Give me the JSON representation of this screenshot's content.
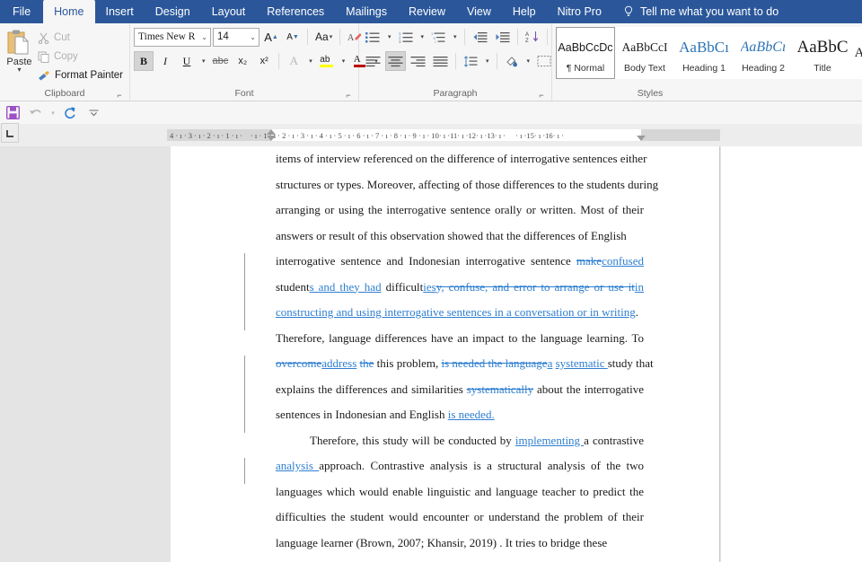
{
  "ribbon": {
    "tabs": [
      {
        "label": "File",
        "kind": "file"
      },
      {
        "label": "Home",
        "kind": "active"
      },
      {
        "label": "Insert",
        "kind": "normal"
      },
      {
        "label": "Design",
        "kind": "normal"
      },
      {
        "label": "Layout",
        "kind": "normal"
      },
      {
        "label": "References",
        "kind": "normal"
      },
      {
        "label": "Mailings",
        "kind": "normal"
      },
      {
        "label": "Review",
        "kind": "normal"
      },
      {
        "label": "View",
        "kind": "normal"
      },
      {
        "label": "Help",
        "kind": "normal"
      },
      {
        "label": "Nitro Pro",
        "kind": "normal"
      }
    ],
    "tellme": "Tell me what you want to do",
    "accent_color": "#2b579a"
  },
  "clipboard": {
    "group_label": "Clipboard",
    "paste_label": "Paste",
    "cut_label": "Cut",
    "copy_label": "Copy",
    "format_painter_label": "Format Painter"
  },
  "font": {
    "group_label": "Font",
    "family": "Times New R",
    "size": "14",
    "bold": "B",
    "italic": "I",
    "underline": "U",
    "strikethrough": "abc",
    "subscript": "x₂",
    "superscript": "x²",
    "change_case": "Aa",
    "grow_font": "A",
    "shrink_font": "A",
    "text_highlight": "ab",
    "font_color": "A"
  },
  "paragraph": {
    "group_label": "Paragraph",
    "pilcrow": "¶",
    "sort": "A\nZ"
  },
  "styles": {
    "group_label": "Styles",
    "items": [
      {
        "preview": "AaBbCcDc",
        "name": "¶ Normal",
        "cls": "sp-normal",
        "selected": true
      },
      {
        "preview": "AaBbCcI",
        "name": "Body Text",
        "cls": "sp-body",
        "selected": false
      },
      {
        "preview": "AaBbCı",
        "name": "Heading 1",
        "cls": "sp-h1",
        "selected": false
      },
      {
        "preview": "AaBbCı",
        "name": "Heading 2",
        "cls": "sp-h2",
        "selected": false
      },
      {
        "preview": "AaBbC",
        "name": "Title",
        "cls": "sp-title",
        "selected": false
      },
      {
        "preview": "A",
        "name": "",
        "cls": "sp-trunc",
        "selected": false
      }
    ]
  },
  "quick_access": {
    "save": "save-icon",
    "undo": "undo-icon",
    "redo": "redo-icon",
    "customize": "customize-icon"
  },
  "ruler": {
    "left_ticks": "4 · ı · 3 · ı · 2 · ı · 1 · ı ·",
    "right_ticks": "· ı · 1 · ı · 2 · ı · 3 · ı · 4 · ı · 5 · ı · 6 · ı · 7 · ı · 8 · ı · 9 · ı · 10· ı ·11· ı ·12· ı ·13· ı ·",
    "tail_ticks": "· ı ·15· ı ·16· ı ·"
  },
  "document": {
    "lines": [
      {
        "changed": false,
        "segments": [
          {
            "t": "items of interview referenced on the difference of interrogative sentences either",
            "s": "n"
          }
        ]
      },
      {
        "changed": false,
        "segments": [
          {
            "t": "structures or types. Moreover, affecting of those differences to the students during",
            "s": "n"
          }
        ]
      },
      {
        "changed": false,
        "segments": [
          {
            "t": "arranging or using the interrogative sentence orally or written. Most of their",
            "s": "n"
          }
        ]
      },
      {
        "changed": false,
        "segments": [
          {
            "t": "answers or result of this observation showed that the differences of English",
            "s": "n"
          }
        ]
      },
      {
        "changed": true,
        "segments": [
          {
            "t": "interrogative sentence and Indonesian interrogative sentence ",
            "s": "n"
          },
          {
            "t": "make",
            "s": "d"
          },
          {
            "t": "confused",
            "s": "i"
          }
        ]
      },
      {
        "changed": true,
        "segments": [
          {
            "t": "student",
            "s": "n"
          },
          {
            "t": "s and they had",
            "s": "i"
          },
          {
            "t": " difficult",
            "s": "n"
          },
          {
            "t": "ies",
            "s": "i"
          },
          {
            "t": "y, confuse, and error to arrange or use it",
            "s": "d"
          },
          {
            "t": "in",
            "s": "i"
          }
        ]
      },
      {
        "changed": true,
        "segments": [
          {
            "t": "constructing and using interrogative sentences in a conversation or in writing",
            "s": "i"
          },
          {
            "t": ".",
            "s": "n"
          }
        ]
      },
      {
        "changed": false,
        "segments": [
          {
            "t": "Therefore, language differences have an impact to the language learning. To",
            "s": "n"
          }
        ]
      },
      {
        "changed": true,
        "segments": [
          {
            "t": "overcome",
            "s": "d"
          },
          {
            "t": "address",
            "s": "i"
          },
          {
            "t": " ",
            "s": "n"
          },
          {
            "t": "the",
            "s": "d"
          },
          {
            "t": " this problem, ",
            "s": "n"
          },
          {
            "t": "is needed the language",
            "s": "d"
          },
          {
            "t": "a",
            "s": "i"
          },
          {
            "t": " ",
            "s": "n"
          },
          {
            "t": "systematic ",
            "s": "i"
          },
          {
            "t": "study that",
            "s": "n"
          }
        ]
      },
      {
        "changed": true,
        "segments": [
          {
            "t": "explains the differences and similarities ",
            "s": "n"
          },
          {
            "t": "systematically",
            "s": "d"
          },
          {
            "t": " about the interrogative",
            "s": "n"
          }
        ]
      },
      {
        "changed": true,
        "segments": [
          {
            "t": "sentences in Indonesian and English ",
            "s": "n"
          },
          {
            "t": "is needed.",
            "s": "i"
          }
        ]
      },
      {
        "changed": false,
        "indent": true,
        "segments": [
          {
            "t": "Therefore, this study will be conducted by ",
            "s": "n"
          },
          {
            "t": "implementing ",
            "s": "i"
          },
          {
            "t": "a contrastive",
            "s": "n"
          }
        ]
      },
      {
        "changed": true,
        "segments": [
          {
            "t": "analysis ",
            "s": "i"
          },
          {
            "t": "approach. Contrastive analysis is a structural analysis of the two",
            "s": "n"
          }
        ]
      },
      {
        "changed": false,
        "segments": [
          {
            "t": "languages which would enable linguistic and language teacher to predict the",
            "s": "n"
          }
        ]
      },
      {
        "changed": false,
        "segments": [
          {
            "t": "difficulties the student would encounter or understand the problem of their",
            "s": "n"
          }
        ]
      },
      {
        "changed": false,
        "segments": [
          {
            "t": "language learner (Brown, 2007; Khansir, 2019) .   It tries to bridge these",
            "s": "n"
          }
        ]
      }
    ]
  }
}
